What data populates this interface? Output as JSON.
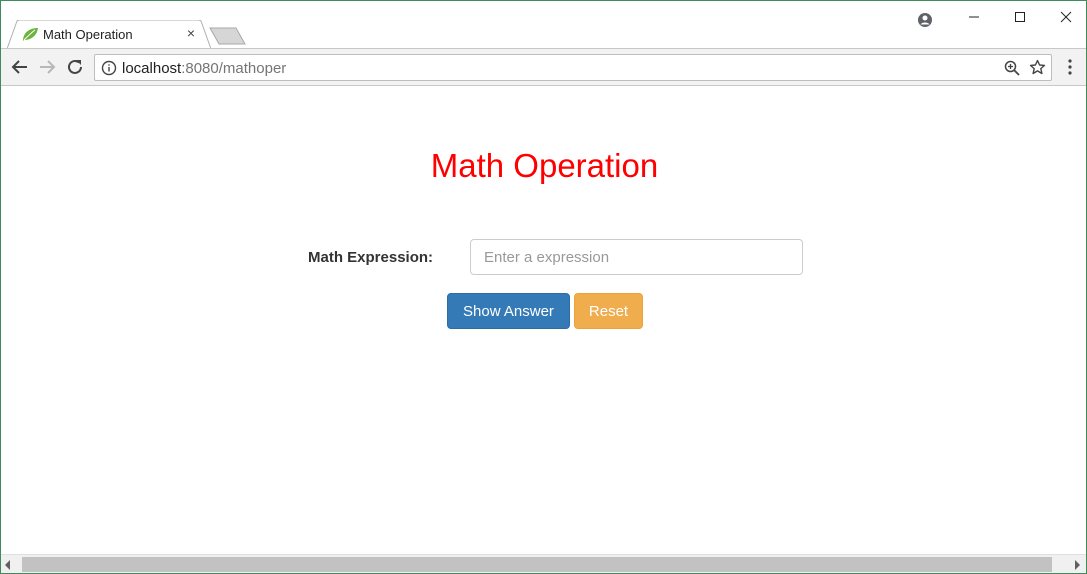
{
  "browser": {
    "tab": {
      "title": "Math Operation",
      "favicon": "spring-leaf-icon",
      "close_glyph": "×"
    },
    "address": {
      "host": "localhost",
      "path": ":8080/mathoper"
    },
    "icons": {
      "back": "arrow-left-icon",
      "forward": "arrow-right-icon",
      "reload": "reload-icon",
      "info": "info-icon",
      "zoom": "zoom-icon",
      "bookmark": "star-icon",
      "menu": "kebab-menu-icon",
      "profile": "profile-icon"
    },
    "colors": {
      "window_border": "#3c8c5c",
      "toolbar_bg": "#f2f2f2"
    }
  },
  "page": {
    "title": "Math Operation",
    "title_color": "#ff0000",
    "form": {
      "label": "Math Expression:",
      "input_value": "",
      "input_placeholder": "Enter a expression"
    },
    "buttons": {
      "show_answer": "Show Answer",
      "reset": "Reset"
    },
    "colors": {
      "primary": "#337ab7",
      "warning": "#f0ad4e"
    }
  }
}
